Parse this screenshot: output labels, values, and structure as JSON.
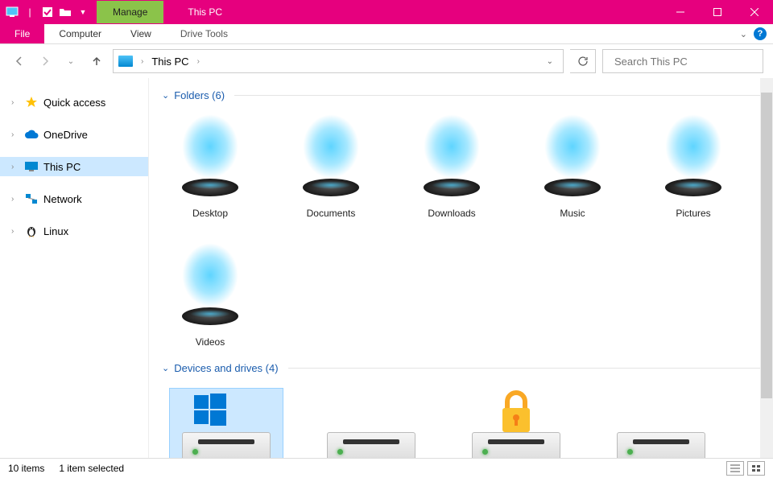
{
  "title_bar": {
    "context_tab": "Manage",
    "context_label": "This PC"
  },
  "ribbon": {
    "file": "File",
    "tabs": [
      "Computer",
      "View"
    ],
    "context_tabs": [
      "Drive Tools"
    ]
  },
  "nav": {
    "location": "This PC",
    "search_placeholder": "Search This PC"
  },
  "sidebar": {
    "items": [
      {
        "label": "Quick access",
        "icon": "star",
        "color": "#ffc107"
      },
      {
        "label": "OneDrive",
        "icon": "cloud",
        "color": "#0078d4"
      },
      {
        "label": "This PC",
        "icon": "monitor",
        "color": "#0288d1",
        "selected": true
      },
      {
        "label": "Network",
        "icon": "network",
        "color": "#0288d1"
      },
      {
        "label": "Linux",
        "icon": "penguin",
        "color": "#222"
      }
    ]
  },
  "content": {
    "groups": [
      {
        "title": "Folders",
        "count": 6,
        "type": "folders",
        "items": [
          {
            "label": "Desktop"
          },
          {
            "label": "Documents"
          },
          {
            "label": "Downloads"
          },
          {
            "label": "Music"
          },
          {
            "label": "Pictures"
          },
          {
            "label": "Videos"
          }
        ]
      },
      {
        "title": "Devices and drives",
        "count": 4,
        "type": "drives",
        "items": [
          {
            "os": true,
            "selected": true
          },
          {},
          {
            "locked": true
          },
          {}
        ]
      }
    ]
  },
  "status": {
    "items": "10 items",
    "selected": "1 item selected"
  }
}
